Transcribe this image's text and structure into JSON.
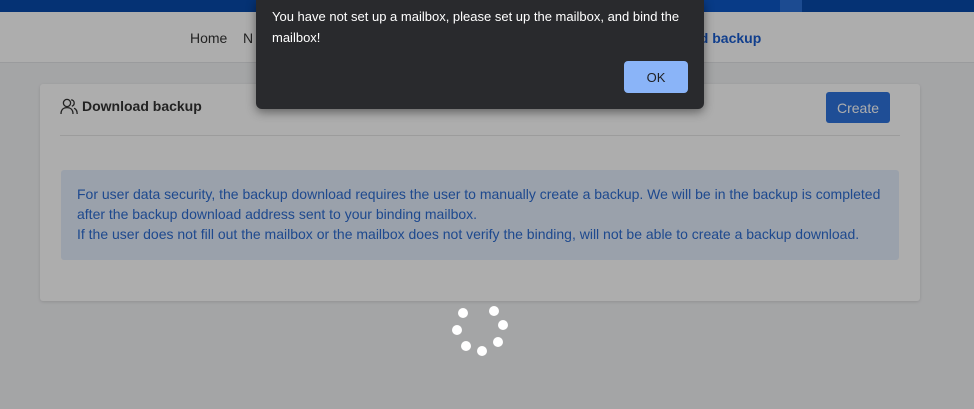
{
  "nav": {
    "home": "Home",
    "partial": "N",
    "current": "ad backup"
  },
  "card": {
    "title": "Download backup",
    "create_label": "Create",
    "notice_line1": "For user data security, the backup download requires the user to manually create a backup. We will be in the backup is completed after the backup download address sent to your binding mailbox.",
    "notice_line2": "If the user does not fill out the mailbox or the mailbox does not verify the binding, will not be able to create a backup download."
  },
  "dialog": {
    "message": "You have not set up a mailbox, please set up the mailbox, and bind the mailbox!",
    "ok_label": "OK"
  },
  "icons": {
    "title_icon": "users-icon",
    "spinner_icon": "loading-spinner-icon"
  },
  "colors": {
    "brand_blue": "#0c58c8",
    "button_blue": "#2f73de",
    "notice_text": "#2d6cd2",
    "dialog_bg": "#292a2d",
    "dialog_button": "#8ab4f8"
  }
}
